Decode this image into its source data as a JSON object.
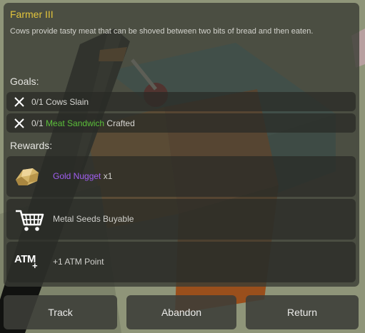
{
  "quest": {
    "title": "Farmer III",
    "description": "Cows provide tasty meat that can be shoved between two bits of bread and then eaten."
  },
  "goals": {
    "label": "Goals:",
    "items": [
      {
        "progress": "0/1",
        "text": "Cows Slain",
        "icon": "close-icon"
      },
      {
        "progress": "0/1",
        "highlight": "Meat Sandwich",
        "text": "Crafted",
        "icon": "close-icon",
        "highlight_color": "#5bbf3a"
      }
    ]
  },
  "rewards": {
    "label": "Rewards:",
    "items": [
      {
        "item": "Gold Nugget",
        "suffix": "x1",
        "icon": "gold-nugget-icon",
        "item_color": "#a05ef0"
      },
      {
        "text": "Metal Seeds Buyable",
        "icon": "shopping-cart-icon"
      },
      {
        "icon_text": "ATM",
        "icon_plus": "+",
        "text": "+1 ATM Point",
        "icon": "atm-icon"
      }
    ]
  },
  "buttons": {
    "track": "Track",
    "abandon": "Abandon",
    "return": "Return"
  },
  "colors": {
    "title": "#e2c43c",
    "highlight": "#5bbf3a",
    "item": "#a05ef0"
  }
}
